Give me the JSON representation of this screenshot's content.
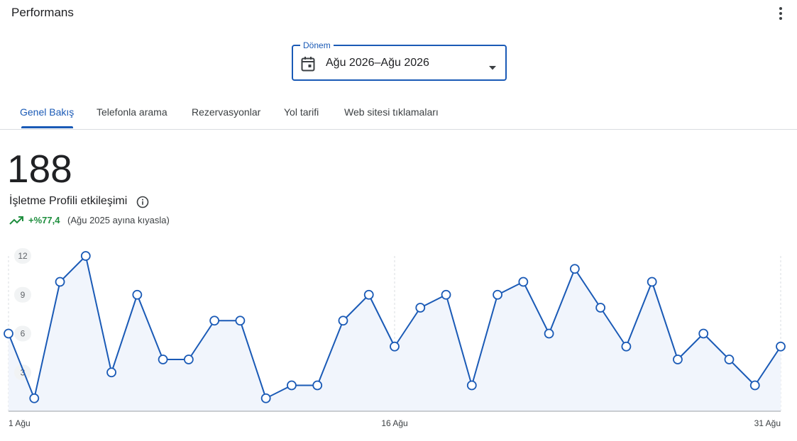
{
  "header": {
    "title": "Performans",
    "menu_icon": "more-vert-icon"
  },
  "period": {
    "label": "Dönem",
    "value": "Ağu 2026–Ağu 2026",
    "icon": "calendar-icon"
  },
  "tabs": [
    {
      "label": "Genel Bakış",
      "active": true
    },
    {
      "label": "Telefonla arama",
      "active": false
    },
    {
      "label": "Rezervasyonlar",
      "active": false
    },
    {
      "label": "Yol tarifi",
      "active": false
    },
    {
      "label": "Web sitesi tıklamaları",
      "active": false
    }
  ],
  "summary": {
    "total": "188",
    "label": "İşletme Profili etkileşimi",
    "change": "+%77,4",
    "comparison": "(Ağu 2025 ayına kıyasla)"
  },
  "colors": {
    "accent": "#1a5ab6",
    "positive": "#1e8e3e",
    "area_fill": "#f1f5fc"
  },
  "chart_data": {
    "type": "area",
    "x": [
      1,
      2,
      3,
      4,
      5,
      6,
      7,
      8,
      9,
      10,
      11,
      12,
      13,
      14,
      15,
      16,
      17,
      18,
      19,
      20,
      21,
      22,
      23,
      24,
      25,
      26,
      27,
      28,
      29,
      30,
      31
    ],
    "values": [
      6,
      1,
      10,
      12,
      3,
      9,
      4,
      4,
      7,
      7,
      1,
      2,
      2,
      7,
      9,
      5,
      8,
      9,
      2,
      9,
      10,
      6,
      11,
      8,
      5,
      10,
      4,
      6,
      4,
      2,
      5
    ],
    "x_tick_labels": [
      "1 Ağu",
      "16 Ağu",
      "31 Ağu"
    ],
    "x_tick_positions": [
      1,
      16,
      31
    ],
    "y_ticks": [
      3,
      6,
      9,
      12
    ],
    "ylim": [
      0,
      12
    ],
    "grid": "vertical-dashed"
  }
}
